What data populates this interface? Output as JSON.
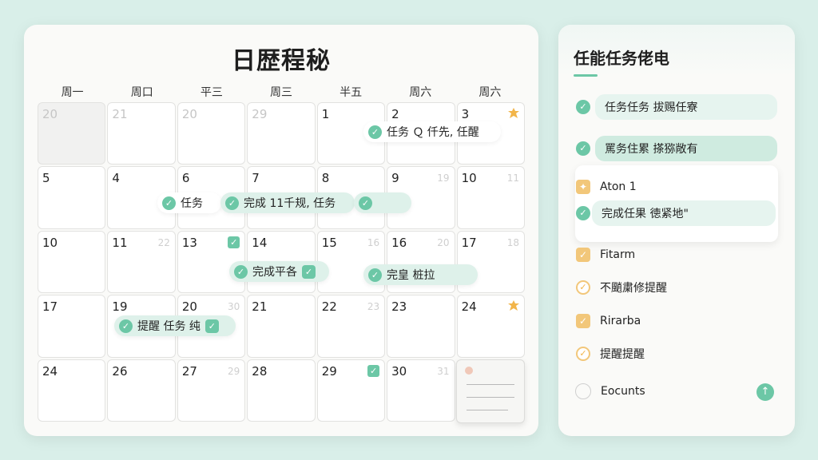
{
  "calendar": {
    "title": "日歴程秘",
    "weekdays": [
      "周一",
      "周口",
      "平三",
      "周三",
      "半五",
      "周六",
      "周六"
    ],
    "cells": [
      {
        "num": "20",
        "muted": true
      },
      {
        "num": "21",
        "faded": true
      },
      {
        "num": "20",
        "faded": true
      },
      {
        "num": "29",
        "faded": true
      },
      {
        "num": "1"
      },
      {
        "num": "2"
      },
      {
        "num": "3",
        "icon": "maple-leaf-icon"
      },
      {
        "num": "5"
      },
      {
        "num": "4"
      },
      {
        "num": "6"
      },
      {
        "num": "7"
      },
      {
        "num": "8"
      },
      {
        "num": "9",
        "sub": "19"
      },
      {
        "num": "10",
        "sub": "11"
      },
      {
        "num": "10"
      },
      {
        "num": "11",
        "sub": "22"
      },
      {
        "num": "13",
        "check": true
      },
      {
        "num": "14"
      },
      {
        "num": "15",
        "sub": "16"
      },
      {
        "num": "16",
        "sub": "20"
      },
      {
        "num": "17",
        "sub": "18"
      },
      {
        "num": "17"
      },
      {
        "num": "19"
      },
      {
        "num": "20",
        "sub": "30"
      },
      {
        "num": "21"
      },
      {
        "num": "22",
        "sub": "23"
      },
      {
        "num": "23"
      },
      {
        "num": "24",
        "icon": "maple-leaf-icon"
      },
      {
        "num": "24"
      },
      {
        "num": "26"
      },
      {
        "num": "27",
        "sub": "29"
      },
      {
        "num": "28"
      },
      {
        "num": "29",
        "check": true
      },
      {
        "num": "30",
        "sub": "31"
      },
      {
        "num": ""
      }
    ],
    "events": [
      {
        "label": "任务 Ｑ 仟先, 任醒"
      },
      {
        "label": "任务"
      },
      {
        "label": "完成 11千规, 任务"
      },
      {
        "label": "完成平各"
      },
      {
        "label": "完皇 桩拉"
      },
      {
        "label": "提醒 任务 纯"
      }
    ]
  },
  "sidebar": {
    "title": "任能任务佬电",
    "tasks": [
      {
        "label": "任务任务 拔赐任寮"
      },
      {
        "label": "罵务住累 搽猕敞有"
      },
      {
        "label": "Aton 1"
      },
      {
        "label": "完成任果 徳紧地\""
      },
      {
        "label": "Fitarm"
      },
      {
        "label": "不颵粛修提醒"
      },
      {
        "label": "Rirarba"
      },
      {
        "label": "提醒提醒"
      },
      {
        "label": "Eocunts"
      }
    ]
  }
}
